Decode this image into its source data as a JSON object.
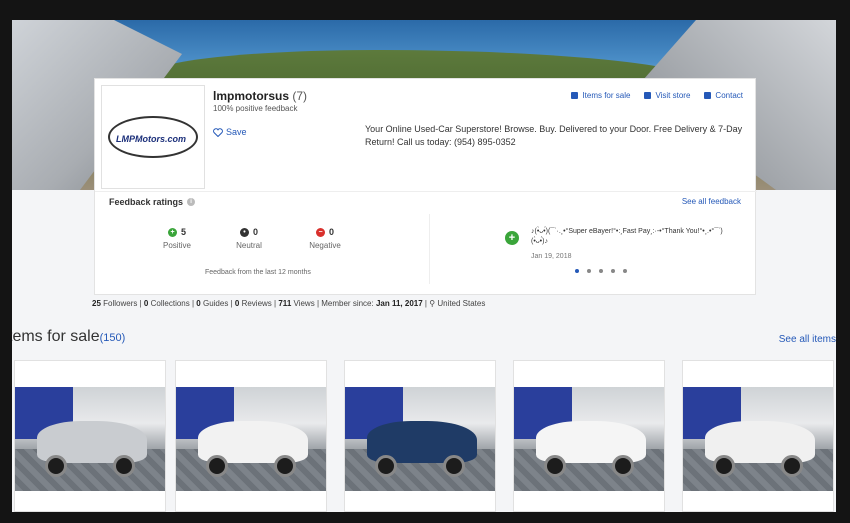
{
  "seller": {
    "name": "lmpmotorsus",
    "count": "(7)",
    "positive_feedback": "100% positive feedback",
    "save_label": "Save",
    "logo_text": "LMPMotors.com",
    "tagline": "Your Online Used-Car Superstore! Browse. Buy. Delivered to your Door. Free Delivery & 7-Day Return! Call us today: (954) 895-0352"
  },
  "top_links": {
    "items_for_sale": "Items for sale",
    "visit_store": "Visit store",
    "contact": "Contact"
  },
  "feedback": {
    "title": "Feedback ratings",
    "see_all": "See all feedback",
    "positive_value": "5",
    "positive_label": "Positive",
    "neutral_value": "0",
    "neutral_label": "Neutral",
    "negative_value": "0",
    "negative_label": "Negative",
    "period": "Feedback from the last 12 months",
    "comment": "♪(•̀ᴗ•́)(¯`·.¸•°Super eBayer!°•:¸Fast Pay¸:·-•°Thank You!°•¸.•°¯`)(•̀ᴗ•́)♪",
    "comment_date": "Jan 19, 2018"
  },
  "stats": {
    "followers_num": "25",
    "followers_label": "Followers",
    "collections_num": "0",
    "collections_label": "Collections",
    "guides_num": "0",
    "guides_label": "Guides",
    "reviews_num": "0",
    "reviews_label": "Reviews",
    "views_num": "711",
    "views_label": "Views",
    "member_since_label": "Member since:",
    "member_since_date": "Jan 11, 2017",
    "location": "United States"
  },
  "items": {
    "title": "tems for sale",
    "count": "(150)",
    "see_all": "See all items"
  },
  "colors": {
    "link": "#2559b8",
    "positive": "#3aa53a",
    "neutral": "#333333",
    "negative": "#d9302c",
    "showroom_wall": "#2a3f9c"
  }
}
